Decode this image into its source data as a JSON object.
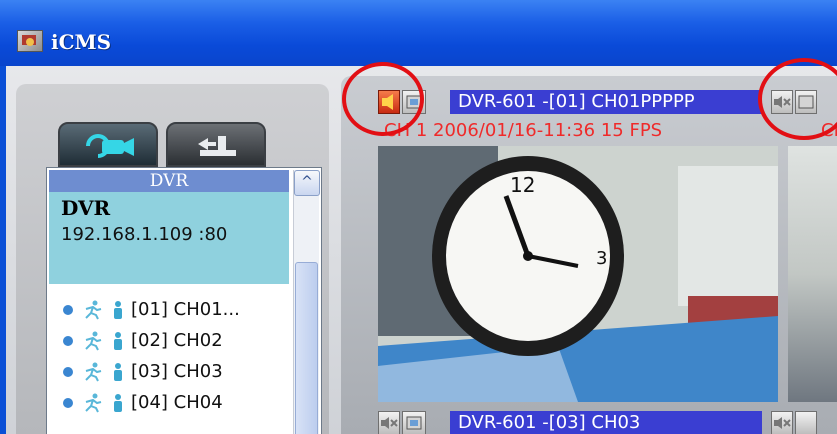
{
  "window": {
    "title": "iCMS"
  },
  "sidebar": {
    "tabs": [
      {
        "name": "camera-tab"
      },
      {
        "name": "login-tab"
      }
    ],
    "list_header": "DVR",
    "device": {
      "name": "DVR",
      "ip": "192.168.1.109 :80"
    },
    "channels": [
      {
        "label": "[01] CH01..."
      },
      {
        "label": "[02] CH02"
      },
      {
        "label": "[03] CH03"
      },
      {
        "label": "[04] CH04"
      }
    ]
  },
  "video": {
    "cam1": {
      "header": "DVR-601 -[01] CH01PPPPP",
      "overlay": "CH 1 2006/01/16-11:36 15 FPS",
      "overlay_right": "CH"
    },
    "cam3": {
      "header": "DVR-601 -[03] CH03"
    }
  },
  "colors": {
    "titlebar": "#0a4ad8",
    "header_bar": "#3a3ed2",
    "list_header": "#6e8dd0",
    "device_info_bg": "#8fd1de",
    "callout": "#e20f14",
    "overlay_text": "#ef2a2a"
  }
}
